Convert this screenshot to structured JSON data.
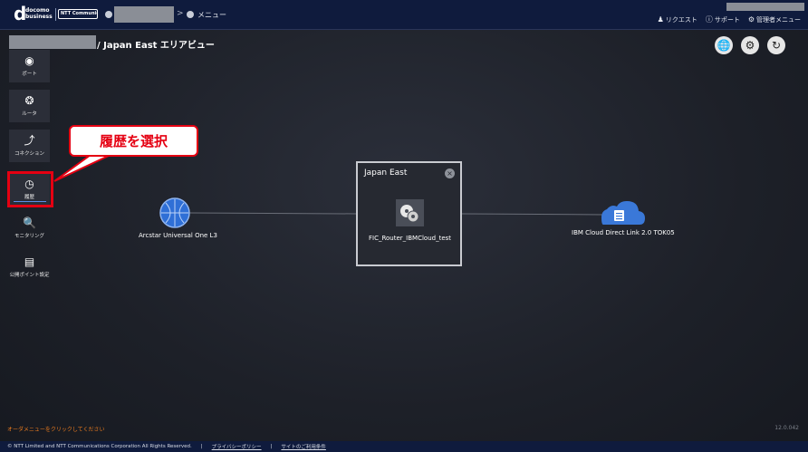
{
  "header": {
    "logo_mark": "d",
    "logo_line1": "docomo",
    "logo_line2": "business",
    "ntt_logo": "NTT Communications",
    "breadcrumb_menu": "メニュー",
    "links": [
      {
        "icon": "user-icon",
        "label": "リクエスト"
      },
      {
        "icon": "help-icon",
        "label": "サポート"
      },
      {
        "icon": "gear-icon",
        "label": "管理者メニュー"
      }
    ]
  },
  "page": {
    "title": "/ Japan East エリアビュー"
  },
  "sidebar": {
    "items": [
      {
        "icon": "port-icon",
        "label": "ポート"
      },
      {
        "icon": "router-icon",
        "label": "ルータ"
      },
      {
        "icon": "connection-icon",
        "label": "コネクション"
      },
      {
        "icon": "history-icon",
        "label": "履歴"
      },
      {
        "icon": "monitoring-icon",
        "label": "モニタリング"
      },
      {
        "icon": "public-ip-icon",
        "label": "公開ポイント設定"
      }
    ]
  },
  "callout": {
    "text": "履歴を選択"
  },
  "diagram": {
    "left_node": "Arcstar Universal One L3",
    "region_title": "Japan East",
    "router_label": "FIC_Router_IBMCloud_test",
    "right_node": "IBM Cloud Direct Link 2.0 TOK05"
  },
  "status": {
    "message": "オーダメニューをクリックしてください",
    "version": "12.0.042"
  },
  "footer": {
    "copyright": "© NTT Limited and NTT Communications Corporation All Rights Reserved.",
    "privacy": "プライバシーポリシー",
    "terms": "サイトのご利用条件"
  },
  "colors": {
    "highlight": "#e50012",
    "topbar": "#0f1b3d",
    "status_text": "#e87a1f",
    "node_blue": "#2f6fd6"
  }
}
